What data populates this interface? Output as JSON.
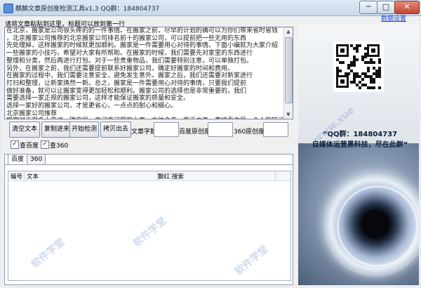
{
  "window": {
    "title": "麒麟文章原创度检测工具v1.3  QQ群：184804737",
    "minimize_label": "─",
    "maximize_label": "□",
    "close_label": "✕"
  },
  "settings_link": "数据设置",
  "input_hint": "请将文章粘贴到这里，标题可以放到第一行",
  "article_lines": [
    "在北京，搬家是公司很头疼的的一件事情。在搬家之前，尽早的计划的确可以为你们带来省时省钱",
    "，北京搬家公司推荐的北京搬家公司排名前十的搬家公司，可以提前把一些无用的东西",
    "先处理掉，这样搬家的时候就更加顺利。搬家是一件需要用心对待的事情。下面小编就为大家介绍",
    "一些搬家的小技巧，希望对大家有所帮助。在搬家的时候，我们需要先对家里的东西进行",
    "整理和分类，然后再进行打包。对于一些贵重物品，我们需要特别注意，可以单独打包。",
    "另外，在搬家之前，我们还需要提前联系好搬家公司，确定好搬家的时间和费用。",
    "在搬家的过程中，我们需要注意安全，避免发生意外。搬家之后，我们还需要对新家进行",
    "打扫和整理，让新家焕然一新。总之，搬家是一件需要用心对待的事情，只要我们提前",
    "做好准备，就可以让搬家变得更加轻松和顺利。搬家公司的选择也是非常重要的，我们",
    "需要选择一家正规的搬家公司，这样才能保证搬家的质量和安全。",
    "选择一家好的搬家公司，才是更省心，一点点的耐心和细心。",
    "北京搬家公司推荐",
    "搬家对于很多人来说，确实是一件可喜可贺的大事。古往今来，乔迁之喜一直被看作是一个人的转运之机，是一个家庭"
  ],
  "buttons": {
    "clear": "清空文本",
    "copy": "复制进来",
    "start": "开始检测",
    "copy_out": "拷贝出去"
  },
  "stats": {
    "word_count_label": "文章字数",
    "word_count_value": "",
    "baidu_label": "百度原创度",
    "baidu_value": "",
    "so360_label": "360原创度",
    "so360_value": ""
  },
  "checkboxes": {
    "baidu_label": "查百度",
    "baidu_checked": true,
    "so360_label": "查360",
    "so360_checked": true
  },
  "tabs": [
    "百度",
    "360"
  ],
  "table_headers": [
    "编号",
    "文本",
    "飘红",
    "搜索"
  ],
  "ad": {
    "qq": "“QQ群：184804737",
    "slogan": "自媒体运营黑科技，尽在此群”"
  },
  "watermarks": [
    "软件学堂",
    "软件学堂",
    "软件学堂",
    "www.xue"
  ]
}
